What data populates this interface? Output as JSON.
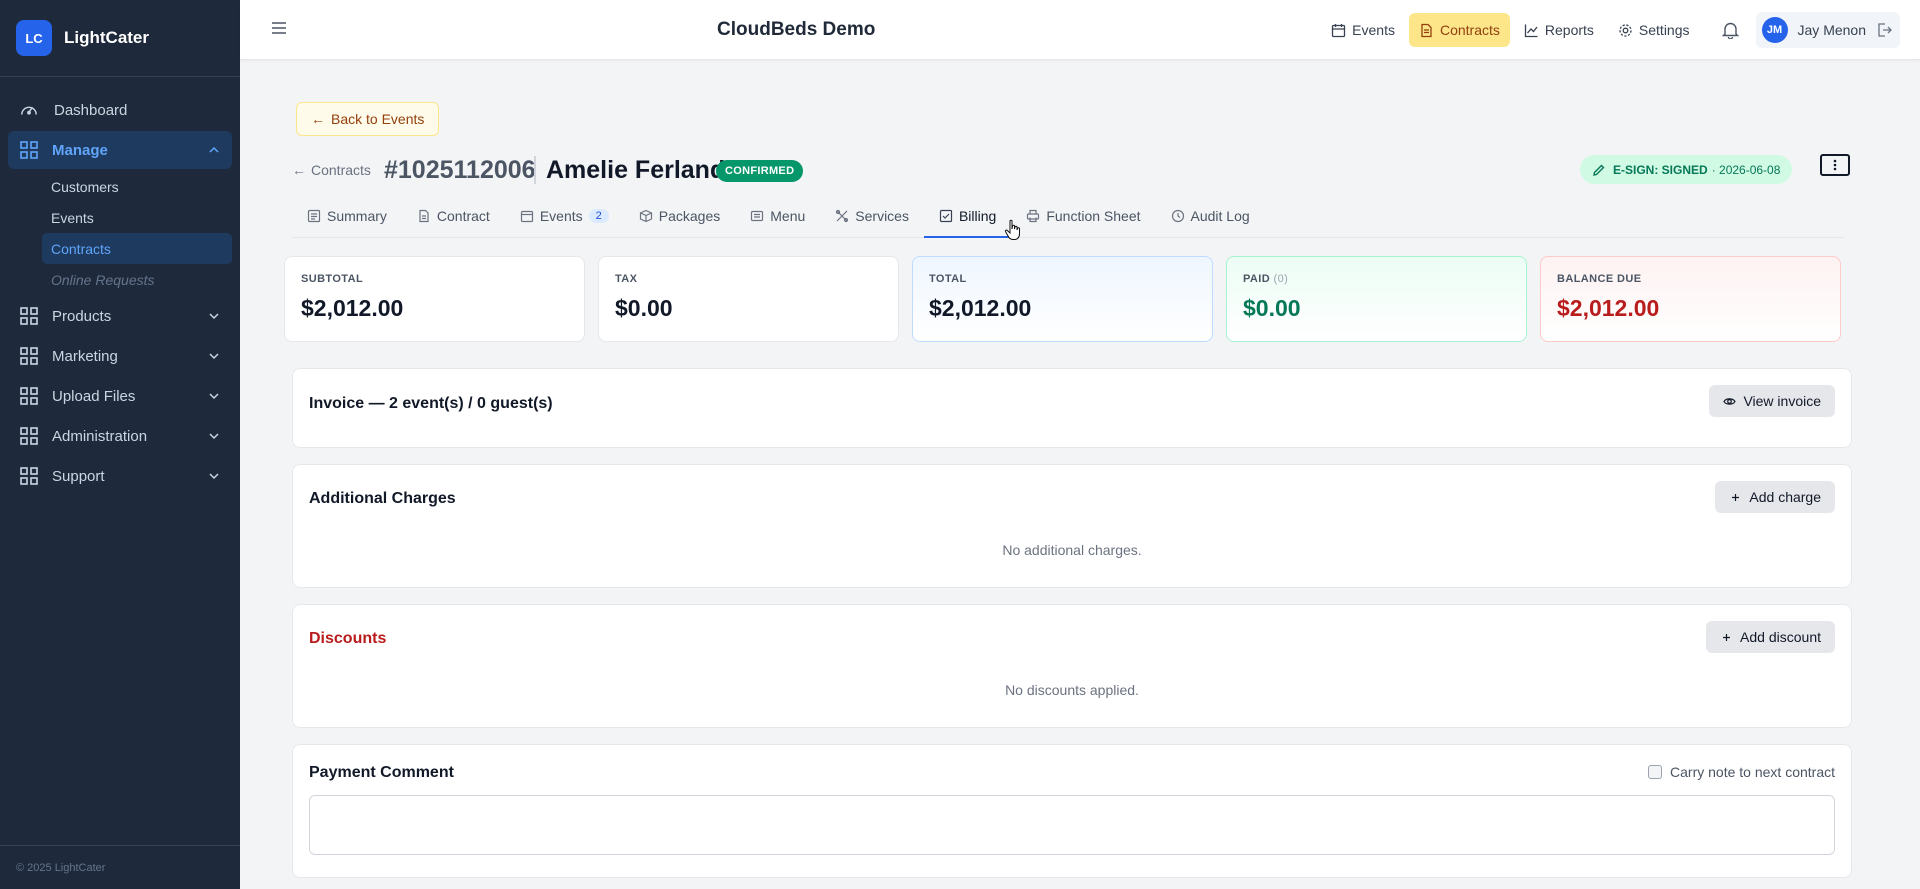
{
  "brand": {
    "logo": "LC",
    "name": "LightCater"
  },
  "sidebar": {
    "dashboard": "Dashboard",
    "manage": "Manage",
    "manage_items": [
      "Customers",
      "Events",
      "Contracts",
      "Online Requests"
    ],
    "groups": [
      "Products",
      "Marketing",
      "Upload Files",
      "Administration",
      "Support"
    ],
    "footer": "© 2025 LightCater"
  },
  "topbar": {
    "title": "CloudBeds Demo",
    "links": [
      "Events",
      "Contracts",
      "Reports",
      "Settings"
    ],
    "user_initials": "JM",
    "user_name": "Jay Menon"
  },
  "page": {
    "back_label": "Back to Events",
    "breadcrumb": "Contracts",
    "contract_number": "#1025112006",
    "client_name": "Amelie Ferland",
    "status": "CONFIRMED",
    "esign_label": "E-SIGN: SIGNED",
    "esign_date": "· 2026-06-08"
  },
  "tabs": [
    {
      "label": "Summary"
    },
    {
      "label": "Contract"
    },
    {
      "label": "Events",
      "count": "2"
    },
    {
      "label": "Packages"
    },
    {
      "label": "Menu"
    },
    {
      "label": "Services"
    },
    {
      "label": "Billing"
    },
    {
      "label": "Function Sheet"
    },
    {
      "label": "Audit Log"
    }
  ],
  "active_tab": "Billing",
  "summary": {
    "subtotal_label": "SUBTOTAL",
    "subtotal": "$2,012.00",
    "tax_label": "TAX",
    "tax": "$0.00",
    "total_label": "TOTAL",
    "total": "$2,012.00",
    "paid_label": "PAID",
    "paid_count": "(0)",
    "paid": "$0.00",
    "balance_label": "BALANCE DUE",
    "balance": "$2,012.00"
  },
  "invoice": {
    "title": "Invoice — 2 event(s) / 0 guest(s)",
    "button": "View invoice"
  },
  "charges": {
    "title": "Additional Charges",
    "button": "Add charge",
    "empty": "No additional charges."
  },
  "discounts": {
    "title": "Discounts",
    "button": "Add discount",
    "empty": "No discounts applied."
  },
  "payment": {
    "title": "Payment Comment",
    "carry_label": "Carry note to next contract",
    "comment": ""
  },
  "colors": {
    "sidebar_bg": "#1e293b",
    "accent": "#2563eb",
    "confirmed": "#059669",
    "balance_red": "#b91c1c",
    "paid_green": "#047857",
    "active_top_link": "#fde68a"
  }
}
